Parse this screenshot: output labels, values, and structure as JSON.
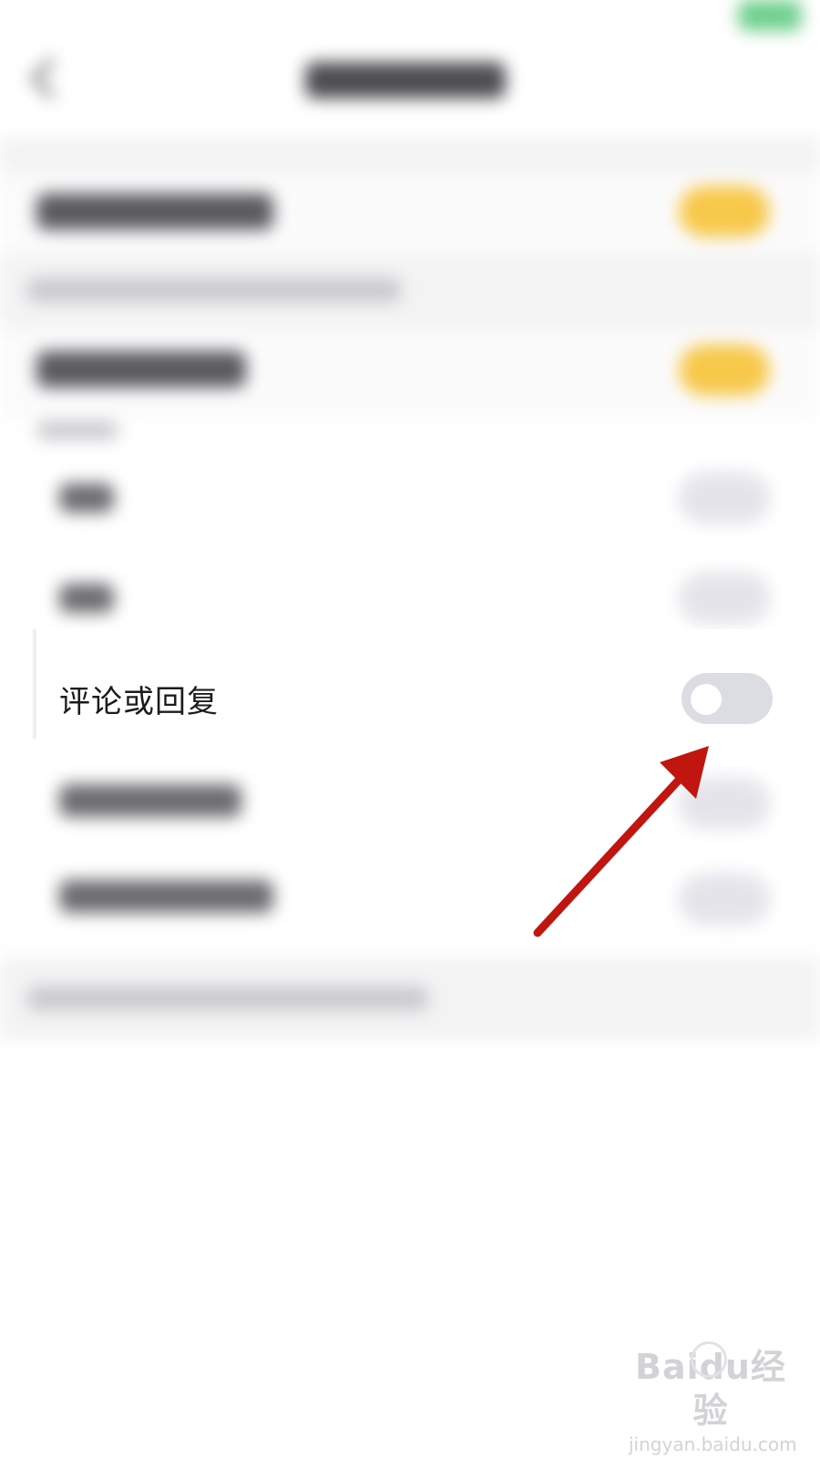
{
  "settings_row": {
    "label": "评论或回复",
    "toggle_state": "off"
  },
  "watermark": {
    "logo_text": "Baidu经验",
    "url_text": "jingyan.baidu.com"
  },
  "colors": {
    "toggle_on": "#f7c84a",
    "toggle_off": "#dcdce3",
    "arrow": "#c0160f",
    "status_indicator": "#6fd08e"
  }
}
